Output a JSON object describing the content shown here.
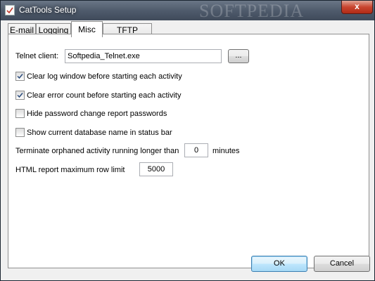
{
  "window": {
    "title": "CatTools Setup",
    "watermark": "SOFTPEDIA",
    "close_glyph": "x"
  },
  "tabs": [
    {
      "label": "E-mail",
      "active": false
    },
    {
      "label": "Logging",
      "active": false
    },
    {
      "label": "Misc",
      "active": true
    },
    {
      "label": "TFTP Server",
      "active": false
    }
  ],
  "misc": {
    "telnet_label": "Telnet client:",
    "telnet_value": "Softpedia_Telnet.exe",
    "browse_label": "...",
    "checkboxes": [
      {
        "label": "Clear log window before starting each activity",
        "checked": true
      },
      {
        "label": "Clear error count before starting each activity",
        "checked": true
      },
      {
        "label": "Hide password change report passwords",
        "checked": false
      },
      {
        "label": "Show current database name in status bar",
        "checked": false
      }
    ],
    "terminate_label": "Terminate orphaned activity running longer than",
    "terminate_value": "0",
    "terminate_unit": "minutes",
    "html_label": "HTML report maximum row limit",
    "html_value": "5000"
  },
  "buttons": {
    "ok": "OK",
    "cancel": "Cancel"
  }
}
